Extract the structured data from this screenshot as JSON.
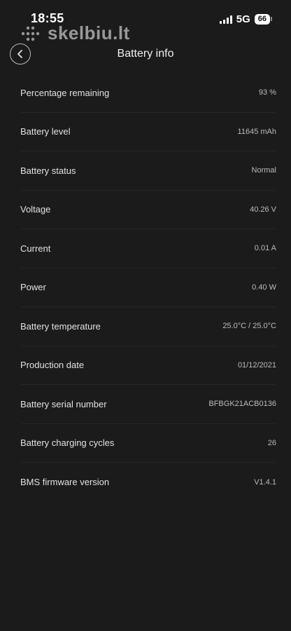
{
  "status_bar": {
    "time": "18:55",
    "network": "5G",
    "battery": "66"
  },
  "watermark": {
    "text": "skelbiu.lt"
  },
  "header": {
    "title": "Battery info",
    "back_icon": "chevron-left-icon"
  },
  "rows": [
    {
      "label": "Percentage remaining",
      "value": "93 %"
    },
    {
      "label": "Battery level",
      "value": "11645 mAh"
    },
    {
      "label": "Battery status",
      "value": "Normal"
    },
    {
      "label": "Voltage",
      "value": "40.26 V"
    },
    {
      "label": "Current",
      "value": "0.01 A"
    },
    {
      "label": "Power",
      "value": "0.40 W"
    },
    {
      "label": "Battery temperature",
      "value": "25.0°C / 25.0°C"
    },
    {
      "label": "Production date",
      "value": "01/12/2021"
    },
    {
      "label": "Battery serial number",
      "value": "BFBGK21ACB0136"
    },
    {
      "label": "Battery charging cycles",
      "value": "26"
    },
    {
      "label": "BMS firmware version",
      "value": "V1.4.1"
    }
  ]
}
